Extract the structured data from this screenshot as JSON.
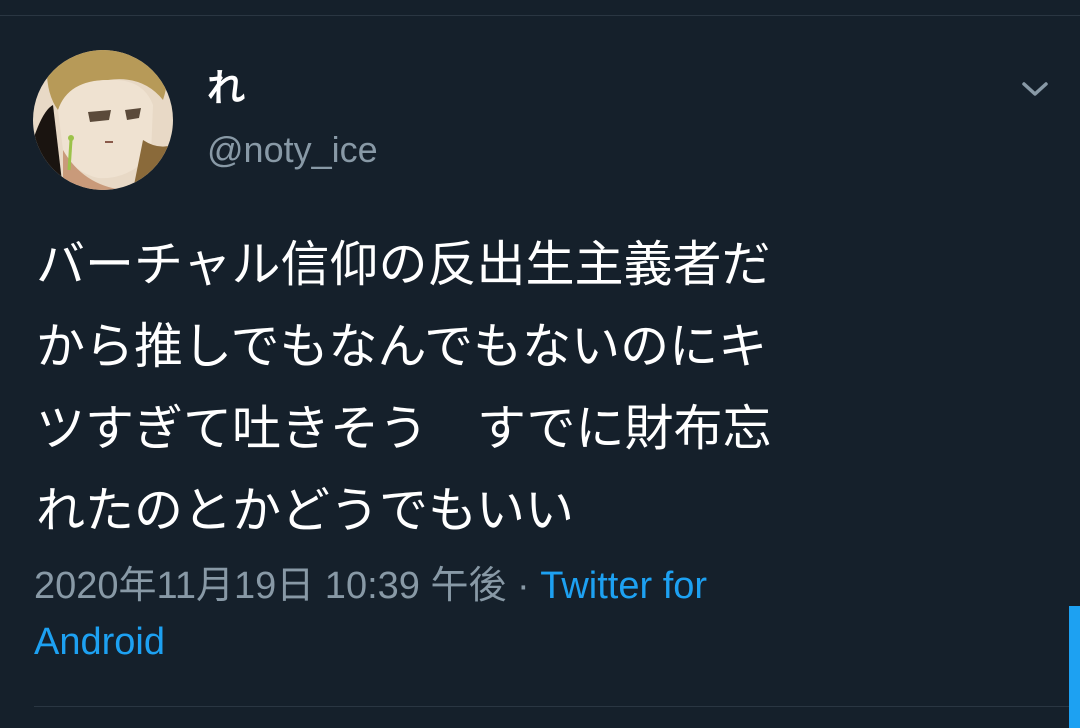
{
  "tweet": {
    "display_name": "れ",
    "username": "@noty_ice",
    "text_lines": [
      "バーチャル信仰の反出生主義者だ",
      "から推しでもなんでもないのにキ",
      "ツすぎて吐きそう　すでに財布忘",
      "れたのとかどうでもいい"
    ],
    "timestamp": "2020年11月19日 10:39 午後",
    "separator": "·",
    "source_line1": "Twitter for",
    "source_line2": "Android"
  },
  "icons": {
    "menu": "chevron-down-icon",
    "avatar": "anime-avatar"
  },
  "colors": {
    "background": "#15202b",
    "text": "#ffffff",
    "secondary": "#8899a6",
    "link": "#1da1f2"
  }
}
